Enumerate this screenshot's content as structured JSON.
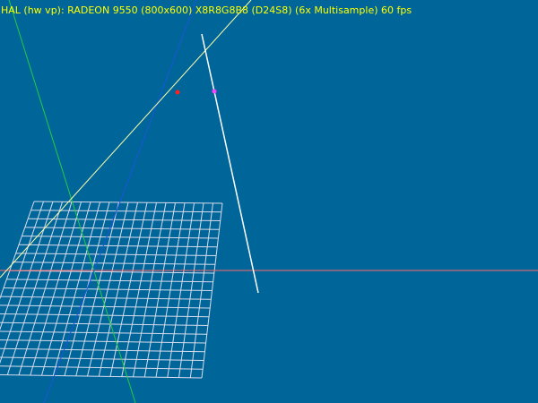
{
  "window": {
    "status_text": "HAL (hw vp): RADEON 9550  (800x600) X8R8G8B8 (D24S8) (6x Multisample) 60 fps"
  },
  "colors": {
    "background": "#006699",
    "status_text": "#ffff00",
    "grid": "#d8dcec",
    "x_axis": "#ff6666",
    "y_axis": "#22cc44",
    "z_axis": "#1a55d9",
    "ray_line": "#ffffaa",
    "white_line": "#ffffff",
    "marker_red": "#ff2020",
    "marker_magenta": "#ff40ff"
  },
  "scene": {
    "grid_divisions": 20
  }
}
